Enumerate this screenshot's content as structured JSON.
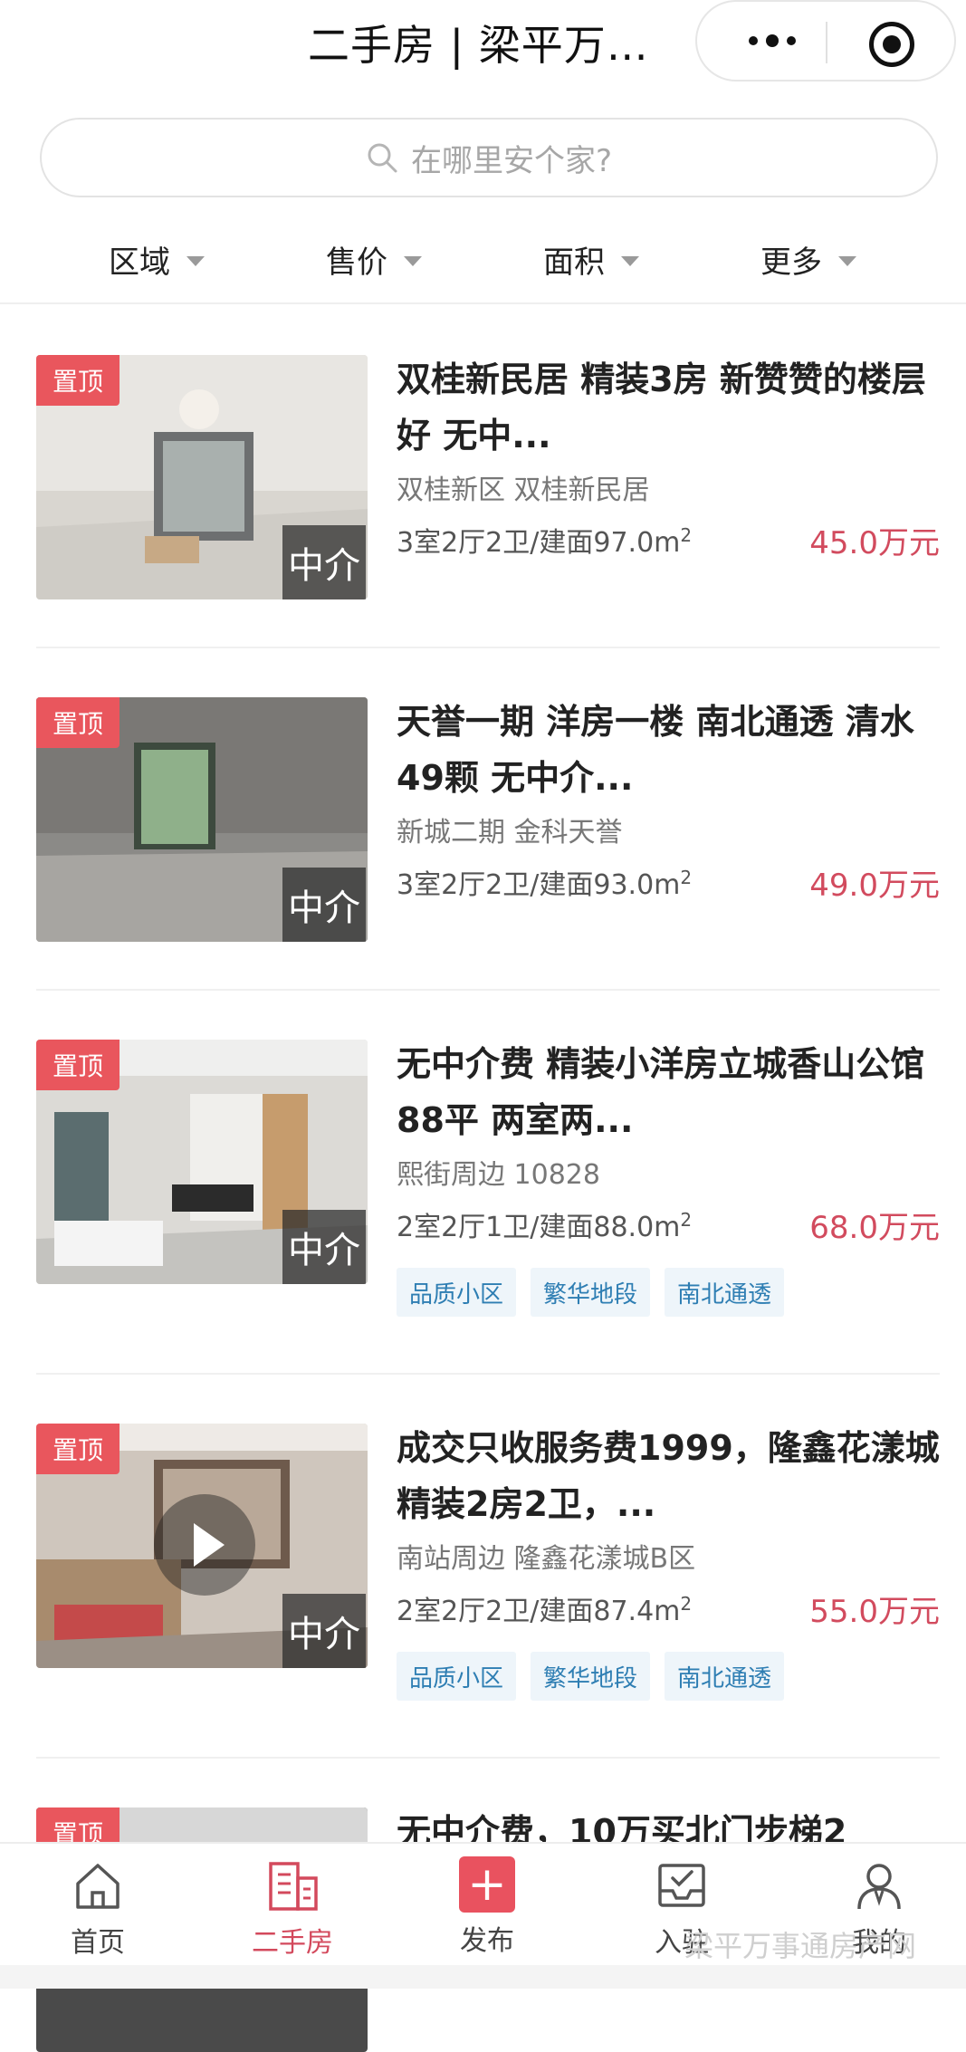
{
  "header": {
    "title": "二手房 | 梁平万…"
  },
  "search": {
    "placeholder": "在哪里安个家?"
  },
  "filters": [
    "区域",
    "售价",
    "面积",
    "更多"
  ],
  "badges": {
    "top": "置顶",
    "agent": "中介"
  },
  "listings": [
    {
      "title": "双桂新民居 精装3房 新赞赞的楼层好 无中...",
      "community": "双桂新区 双桂新民居",
      "spec_prefix": "3室2厅2卫/建面97.0m",
      "spec_sup": "2",
      "price": "45.0万元",
      "tags": []
    },
    {
      "title": "天誉一期 洋房一楼 南北通透 清水49颗 无中介...",
      "community": "新城二期 金科天誉",
      "spec_prefix": "3室2厅2卫/建面93.0m",
      "spec_sup": "2",
      "price": "49.0万元",
      "tags": []
    },
    {
      "title": "无中介费 精装小洋房立城香山公馆 88平 两室两...",
      "community": "熙街周边 10828",
      "spec_prefix": "2室2厅1卫/建面88.0m",
      "spec_sup": "2",
      "price": "68.0万元",
      "tags": [
        "品质小区",
        "繁华地段",
        "南北通透"
      ]
    },
    {
      "title": "成交只收服务费1999，隆鑫花漾城精装2房2卫，...",
      "community": "南站周边 隆鑫花漾城B区",
      "spec_prefix": "2室2厅2卫/建面87.4m",
      "spec_sup": "2",
      "price": "55.0万元",
      "tags": [
        "品质小区",
        "繁华地段",
        "南北通透"
      ]
    },
    {
      "title": "无中介费，10万买北门步梯2",
      "community": "",
      "spec_prefix": "",
      "spec_sup": "",
      "price": "",
      "tags": []
    }
  ],
  "bottom_nav": [
    {
      "label": "首页",
      "icon": "home-icon"
    },
    {
      "label": "二手房",
      "icon": "building-icon",
      "active": true
    },
    {
      "label": "发布",
      "icon": "plus-icon"
    },
    {
      "label": "入驻",
      "icon": "inbox-check-icon"
    },
    {
      "label": "我的",
      "icon": "user-icon"
    }
  ],
  "watermark": "梁平万事通房产网",
  "colors": {
    "accent": "#e9565d",
    "price": "#d24b5e",
    "tag_text": "#2e7eb3",
    "tag_bg": "#eef5fa"
  }
}
